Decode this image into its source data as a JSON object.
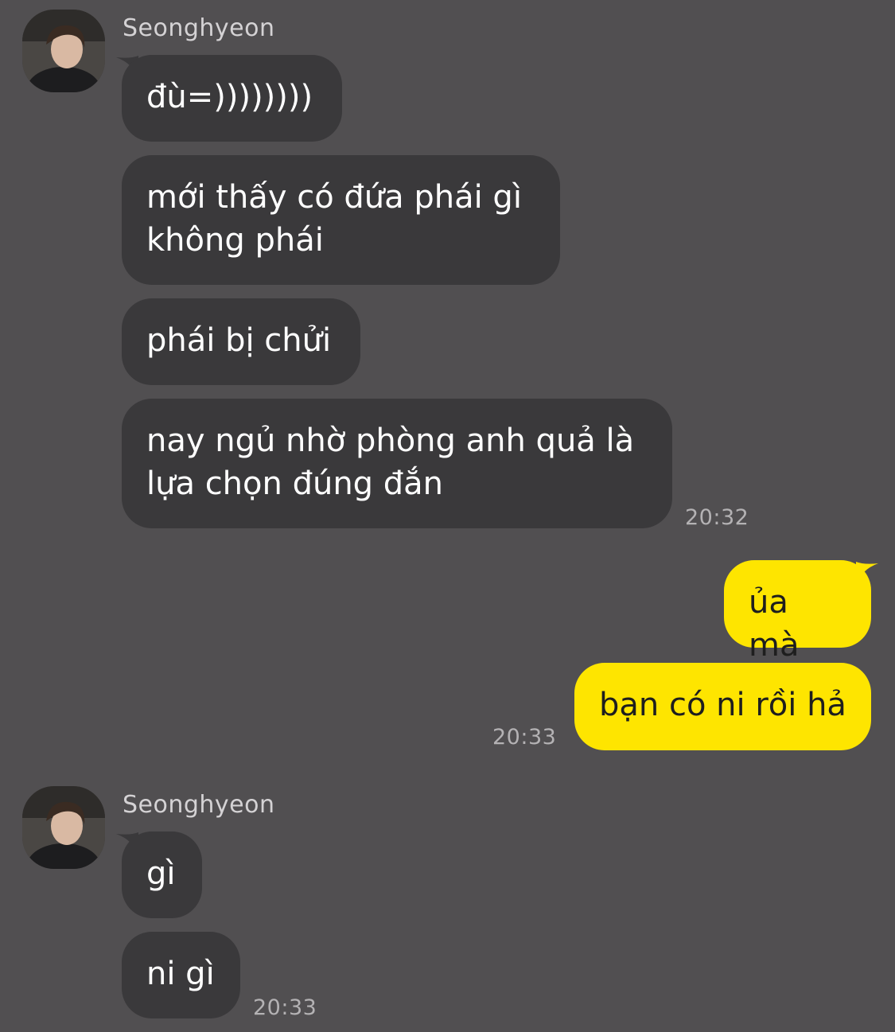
{
  "groups": [
    {
      "sender": "Seonghyeon",
      "messages": [
        "đù=))))))))",
        "mới thấy có đứa phái gì\nkhông phái",
        "phái bị chửi",
        "nay ngủ nhờ phòng anh quả là\nlựa chọn đúng đắn"
      ],
      "time": "20:32"
    },
    {
      "sender": "me",
      "messages": [
        "ủa mà",
        "bạn có ni rồi hả"
      ],
      "time": "20:33"
    },
    {
      "sender": "Seonghyeon",
      "messages": [
        "gì",
        "ni gì"
      ],
      "time": "20:33"
    }
  ],
  "icons": {
    "avatar": "profile-photo",
    "tail": "bubble-tail"
  },
  "colors": {
    "background": "#514f51",
    "incoming_bubble": "#3a393b",
    "outgoing_bubble": "#fee500"
  }
}
